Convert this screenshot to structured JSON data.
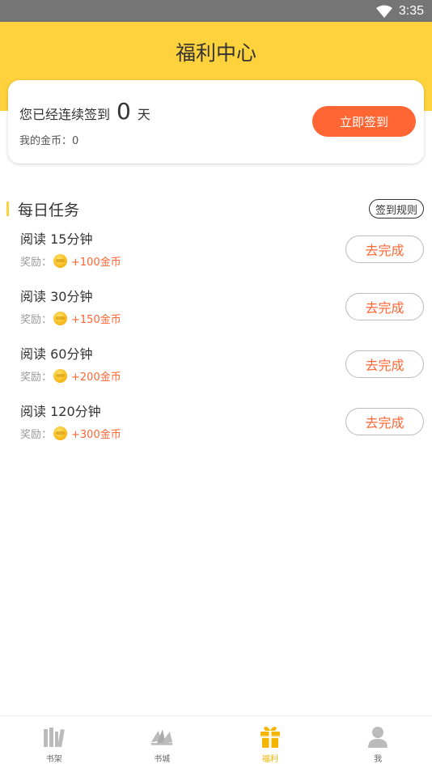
{
  "status_bar": {
    "time": "3:35"
  },
  "header": {
    "title": "福利中心"
  },
  "checkin": {
    "prefix": "您已经连续签到",
    "days": "0",
    "suffix": "天",
    "coins_label": "我的金币：",
    "coins_value": "0",
    "button_label": "立即签到"
  },
  "daily_tasks": {
    "title": "每日任务",
    "rules_label": "签到规则",
    "reward_label": "奖励：",
    "items": [
      {
        "name": "阅读 15分钟",
        "reward": "+100金币",
        "action": "去完成"
      },
      {
        "name": "阅读 30分钟",
        "reward": "+150金币",
        "action": "去完成"
      },
      {
        "name": "阅读 60分钟",
        "reward": "+200金币",
        "action": "去完成"
      },
      {
        "name": "阅读 120分钟",
        "reward": "+300金币",
        "action": "去完成"
      }
    ]
  },
  "tabbar": {
    "tabs": [
      {
        "label": "书架",
        "icon": "bookshelf-icon"
      },
      {
        "label": "书城",
        "icon": "bookstore-icon"
      },
      {
        "label": "福利",
        "icon": "gift-icon",
        "active": true
      },
      {
        "label": "我",
        "icon": "profile-icon"
      }
    ]
  },
  "colors": {
    "brand_yellow": "#fdd23c",
    "accent_orange": "#ff6633",
    "status_bar": "#757575"
  }
}
